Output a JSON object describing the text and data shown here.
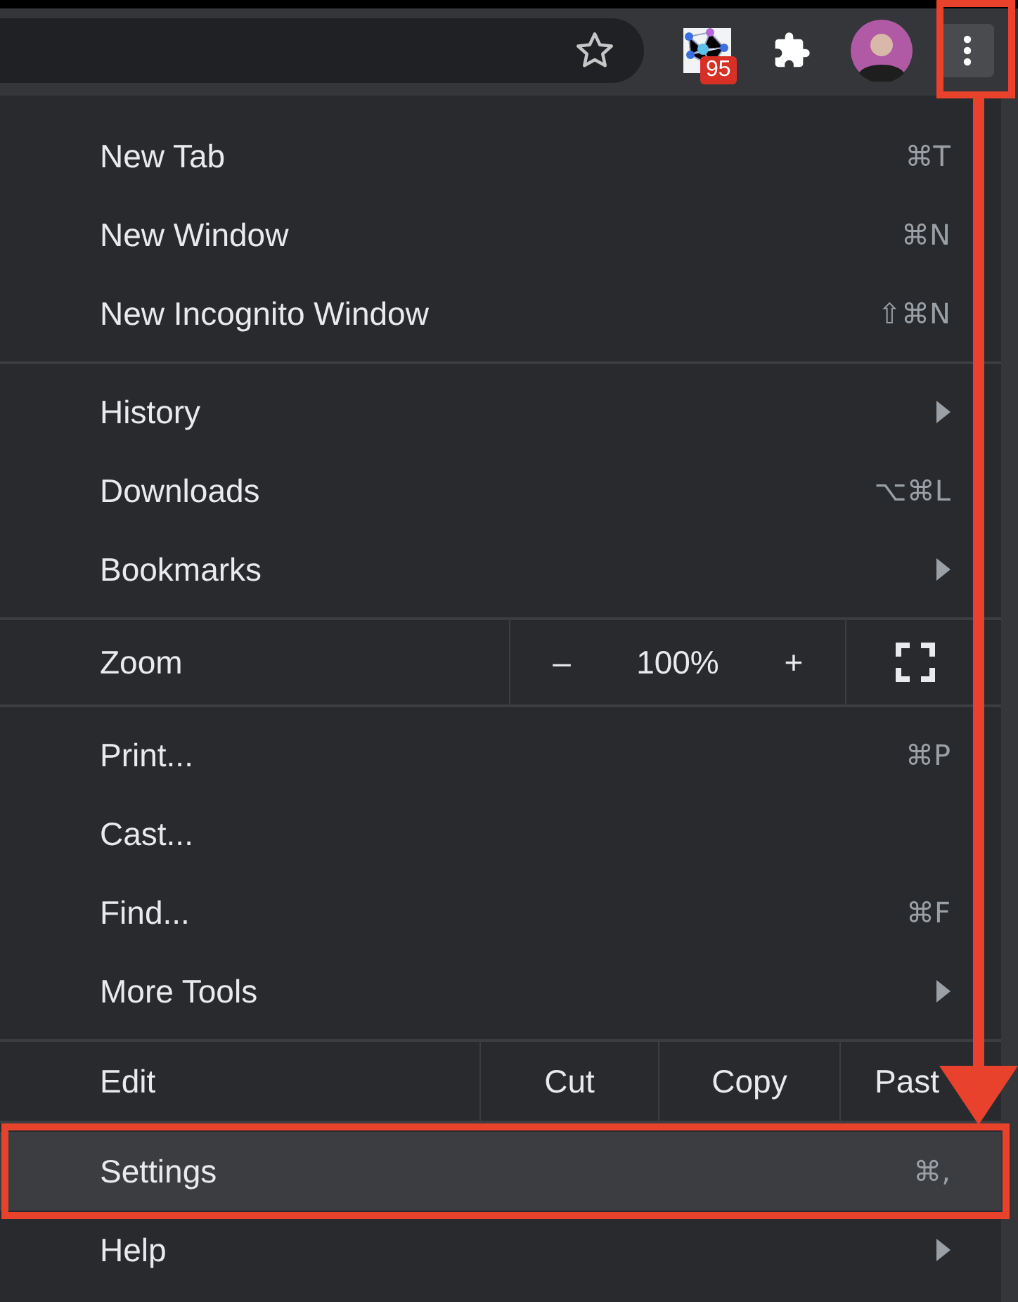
{
  "toolbar": {
    "badge": "95",
    "menu_button": {
      "active": true
    }
  },
  "menu": {
    "groups": [
      {
        "items": [
          {
            "kind": "item",
            "label": "New Tab",
            "shortcut": "⌘T",
            "submenu": false,
            "selected": false
          },
          {
            "kind": "item",
            "label": "New Window",
            "shortcut": "⌘N",
            "submenu": false,
            "selected": false
          },
          {
            "kind": "item",
            "label": "New Incognito Window",
            "shortcut": "⇧⌘N",
            "submenu": false,
            "selected": false
          }
        ]
      },
      {
        "items": [
          {
            "kind": "item",
            "label": "History",
            "submenu": true,
            "selected": false
          },
          {
            "kind": "item",
            "label": "Downloads",
            "shortcut": "⌥⌘L",
            "submenu": false,
            "selected": false
          },
          {
            "kind": "item",
            "label": "Bookmarks",
            "submenu": true,
            "selected": false
          }
        ]
      },
      {
        "items": [
          {
            "kind": "zoom",
            "label": "Zoom",
            "minus": "–",
            "value": "100%",
            "plus": "+"
          }
        ]
      },
      {
        "items": [
          {
            "kind": "item",
            "label": "Print...",
            "shortcut": "⌘P",
            "submenu": false,
            "selected": false
          },
          {
            "kind": "item",
            "label": "Cast...",
            "submenu": false,
            "selected": false
          },
          {
            "kind": "item",
            "label": "Find...",
            "shortcut": "⌘F",
            "submenu": false,
            "selected": false
          },
          {
            "kind": "item",
            "label": "More Tools",
            "submenu": true,
            "selected": false
          }
        ]
      },
      {
        "items": [
          {
            "kind": "edit",
            "label": "Edit",
            "actions": [
              "Cut",
              "Copy",
              "Past"
            ]
          }
        ]
      },
      {
        "items": [
          {
            "kind": "item",
            "label": "Settings",
            "shortcut": "⌘,",
            "submenu": false,
            "selected": true
          },
          {
            "kind": "item",
            "label": "Help",
            "submenu": true,
            "selected": false
          }
        ]
      }
    ]
  }
}
